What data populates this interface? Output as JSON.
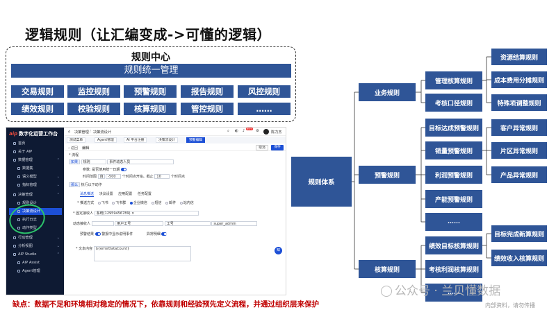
{
  "title": "逻辑规则（让汇编变成->可懂的逻辑）",
  "rule_center": {
    "title": "规则中心",
    "banner": "规则统一管理",
    "rows": [
      [
        "交易规则",
        "监控规则",
        "预警规则",
        "报告规则",
        "风控规则"
      ],
      [
        "绩效规则",
        "校验规则",
        "核算规则",
        "管控规则",
        "……"
      ]
    ]
  },
  "app": {
    "logo_mark": "aip",
    "logo_text": "数字化运营工作台",
    "sidebar": [
      "首页",
      "关于 AIP",
      "数据管理",
      "数据集",
      "语义模型",
      "指标管理",
      "决策管理",
      "规则设计",
      "决策流设计",
      "执行日志",
      "动作类型",
      "行动管理",
      "分析视图",
      "AIP Studio",
      "AIP Assist",
      "Agent管理"
    ],
    "breadcrumb": [
      "决策管理",
      "决策流设计"
    ],
    "user": "陈力杰",
    "badge": "99+",
    "tabs": [
      "测试菜单",
      "Agent管理",
      "AI 平台注册",
      "决策流设计",
      "预警编辑"
    ],
    "back": "返回",
    "edit": "编辑",
    "cancel": "取消",
    "save": "保存",
    "section": "* 流程",
    "cond": {
      "op": "如果",
      "rule": "规则",
      "target": "事件动态人员",
      "param_label": "参数: 是否使用统一日期",
      "time_label": "时间范围",
      "time_unit": "自",
      "time_from": "-500",
      "time_mid": "个时间点开始。截止",
      "time_to": "10",
      "time_end": "个时间点"
    },
    "then_label": "那么",
    "then_text": "执行以下动作",
    "sub_tabs": [
      "消息推送",
      "决议设置",
      "应用配置",
      "任务配置"
    ],
    "push_label": "* 推送方式",
    "channels": [
      "飞书",
      "飞书群",
      "企业微信",
      "短信",
      "邮件",
      "站内信"
    ],
    "fixed_label": "* 固定接收人",
    "fixed_value": "系统(12959456789)",
    "dyn_label": "动态接收人",
    "dyn_field": "用户工号",
    "dyn_field2": "工号",
    "dyn_user": "super_admin",
    "alert_label": "预警结果",
    "alert_text": "警报中显示说明事件",
    "anomaly": "异常明细",
    "msg_label": "* 文本内容",
    "msg_value": "${errorDataCount}",
    "float_btn": "知"
  },
  "caption": "缺点：数据不足和环境相对稳定的情况下，依靠规则和经验预先定义流程，并通过组织层来保护",
  "tree": {
    "root": "规则体系",
    "business": "业务规则",
    "warning": "预警规则",
    "accounting": "核算规则",
    "manage": "管理核算规则",
    "assess": "考核口径规则",
    "resource": "资源结算规则",
    "cost": "成本费用分摊规则",
    "special": "特殊项调整规则",
    "goal_warn": "目标达成预警规则",
    "sales_warn": "销量预警规则",
    "profit_warn": "利润预警规则",
    "product_warn": "产能预警规则",
    "dots": "……",
    "cust": "客户异常规则",
    "region": "片区异常规则",
    "prod_ab": "产品异常规则",
    "perf": "绩效目标核算规则",
    "assess_profit": "考核利润核算规则",
    "goal_new": "目标完成新算规则",
    "eff_income": "绩效收入核算规则"
  },
  "watermark": "公众号 · 兰贝懂数据",
  "watermark2": "内部资料，请勿传播"
}
